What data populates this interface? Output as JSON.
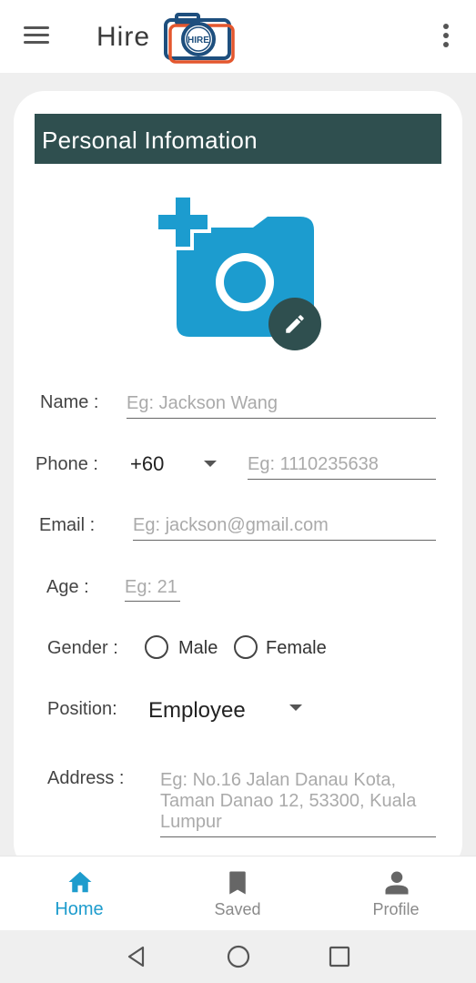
{
  "appbar": {
    "title": "Hire",
    "logo_text": "HIRE",
    "menu_icon": "hamburger-menu-icon",
    "more_icon": "more-vertical-icon"
  },
  "form": {
    "header": "Personal Infomation",
    "photo_icon": "add-photo-icon",
    "edit_icon": "pencil-icon",
    "name": {
      "label": "Name :",
      "placeholder": "Eg: Jackson Wang",
      "value": ""
    },
    "phone": {
      "label": "Phone :",
      "country_code": "+60",
      "placeholder": "Eg: 1110235638",
      "value": ""
    },
    "email": {
      "label": "Email :",
      "placeholder": "Eg: jackson@gmail.com",
      "value": ""
    },
    "age": {
      "label": "Age :",
      "placeholder": "Eg: 21",
      "value": ""
    },
    "gender": {
      "label": "Gender :",
      "options": [
        "Male",
        "Female"
      ],
      "selected": null
    },
    "position": {
      "label": "Position:",
      "value": "Employee"
    },
    "address": {
      "label": "Address :",
      "placeholder": "Eg: No.16 Jalan Danau Kota, Taman Danao 12, 53300, Kuala Lumpur",
      "value": ""
    }
  },
  "bottom_nav": {
    "items": [
      {
        "label": "Home",
        "icon": "home-icon",
        "active": true
      },
      {
        "label": "Saved",
        "icon": "bookmark-icon",
        "active": false
      },
      {
        "label": "Profile",
        "icon": "person-icon",
        "active": false
      }
    ]
  },
  "colors": {
    "header_bg": "#2f4f4f",
    "accent": "#1e9ccd",
    "photo_icon": "#1c9ccf",
    "logo_blue": "#1e4f7e",
    "logo_orange": "#e4572e"
  }
}
